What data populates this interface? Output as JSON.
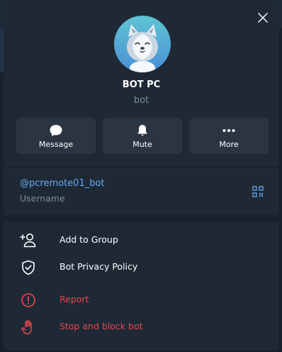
{
  "profile": {
    "name": "BOT PC",
    "subtitle": "bot"
  },
  "actions": [
    {
      "label": "Message",
      "icon": "chat-bubble-icon"
    },
    {
      "label": "Mute",
      "icon": "bell-icon"
    },
    {
      "label": "More",
      "icon": "more-dots-icon"
    }
  ],
  "username": {
    "value": "@pcremote01_bot",
    "caption": "Username"
  },
  "menu": [
    {
      "label": "Add to Group",
      "icon": "add-user-icon",
      "danger": false
    },
    {
      "label": "Bot Privacy Policy",
      "icon": "shield-check-icon",
      "danger": false
    },
    {
      "label": "Report",
      "icon": "alert-circle-icon",
      "danger": true
    },
    {
      "label": "Stop and block bot",
      "icon": "hand-stop-icon",
      "danger": true
    }
  ],
  "colors": {
    "panel": "#1f2936",
    "button": "#2b3542",
    "link": "#66aaee",
    "muted": "#7d8b99",
    "danger": "#e5484d"
  }
}
